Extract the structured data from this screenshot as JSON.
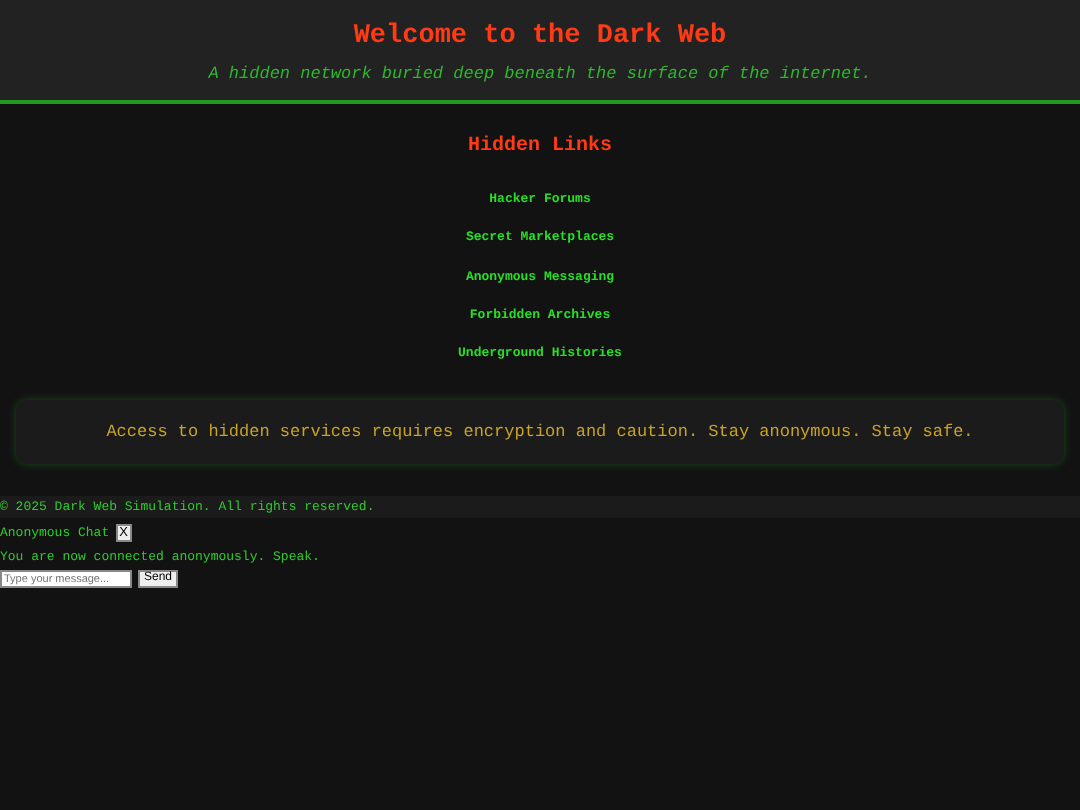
{
  "header": {
    "title": "Welcome to the Dark Web",
    "subtitle": "A hidden network buried deep beneath the surface of the internet."
  },
  "links_section": {
    "heading": "Hidden Links",
    "links": [
      "Hacker Forums",
      "Secret Marketplaces",
      "Anonymous Messaging",
      "Forbidden Archives",
      "Underground Histories"
    ]
  },
  "notice": "Access to hidden services requires encryption and caution. Stay anonymous. Stay safe.",
  "footer": "© 2025 Dark Web Simulation. All rights reserved.",
  "chat": {
    "title": "Anonymous Chat",
    "close": "X",
    "message": "You are now connected anonymously. Speak.",
    "input": {
      "placeholder": "Type your message..."
    },
    "send": "Send"
  }
}
